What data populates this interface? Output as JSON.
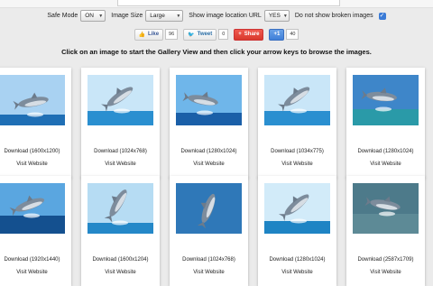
{
  "options": {
    "safe_mode_label": "Safe Mode",
    "safe_mode_value": "ON",
    "image_size_label": "Image Size",
    "image_size_value": "Large",
    "show_url_label": "Show image location URL",
    "show_url_value": "YES",
    "broken_label": "Do not show broken images",
    "broken_checked": true
  },
  "share": {
    "like_label": "Like",
    "like_count": "96",
    "tweet_label": "Tweet",
    "tweet_count": "0",
    "share_label": "Share",
    "plus_label": "+1",
    "plus_count": "40"
  },
  "instruction": "Click on an image to start the Gallery View and then click your arrow keys to browse the images.",
  "visit_label": "Visit Website",
  "images": [
    {
      "download": "Download (1600x1200)",
      "icon": "dolphin-photo"
    },
    {
      "download": "Download (1024x768)",
      "icon": "dolphin-photo"
    },
    {
      "download": "Download (1280x1024)",
      "icon": "dolphin-photo"
    },
    {
      "download": "Download (1034x775)",
      "icon": "dolphin-photo"
    },
    {
      "download": "Download (1280x1024)",
      "icon": "dolphin-photo"
    },
    {
      "download": "Download (1920x1440)",
      "icon": "dolphin-photo"
    },
    {
      "download": "Download (1600x1204)",
      "icon": "dolphin-photo"
    },
    {
      "download": "Download (1024x768)",
      "icon": "dolphin-photo"
    },
    {
      "download": "Download (1280x1024)",
      "icon": "dolphin-photo"
    },
    {
      "download": "Download (2587x1709)",
      "icon": "dolphin-photo"
    }
  ],
  "colors": {
    "sea": "#1c6fb0",
    "sky": "#8fc4ea",
    "check": "#3b7bd6"
  }
}
